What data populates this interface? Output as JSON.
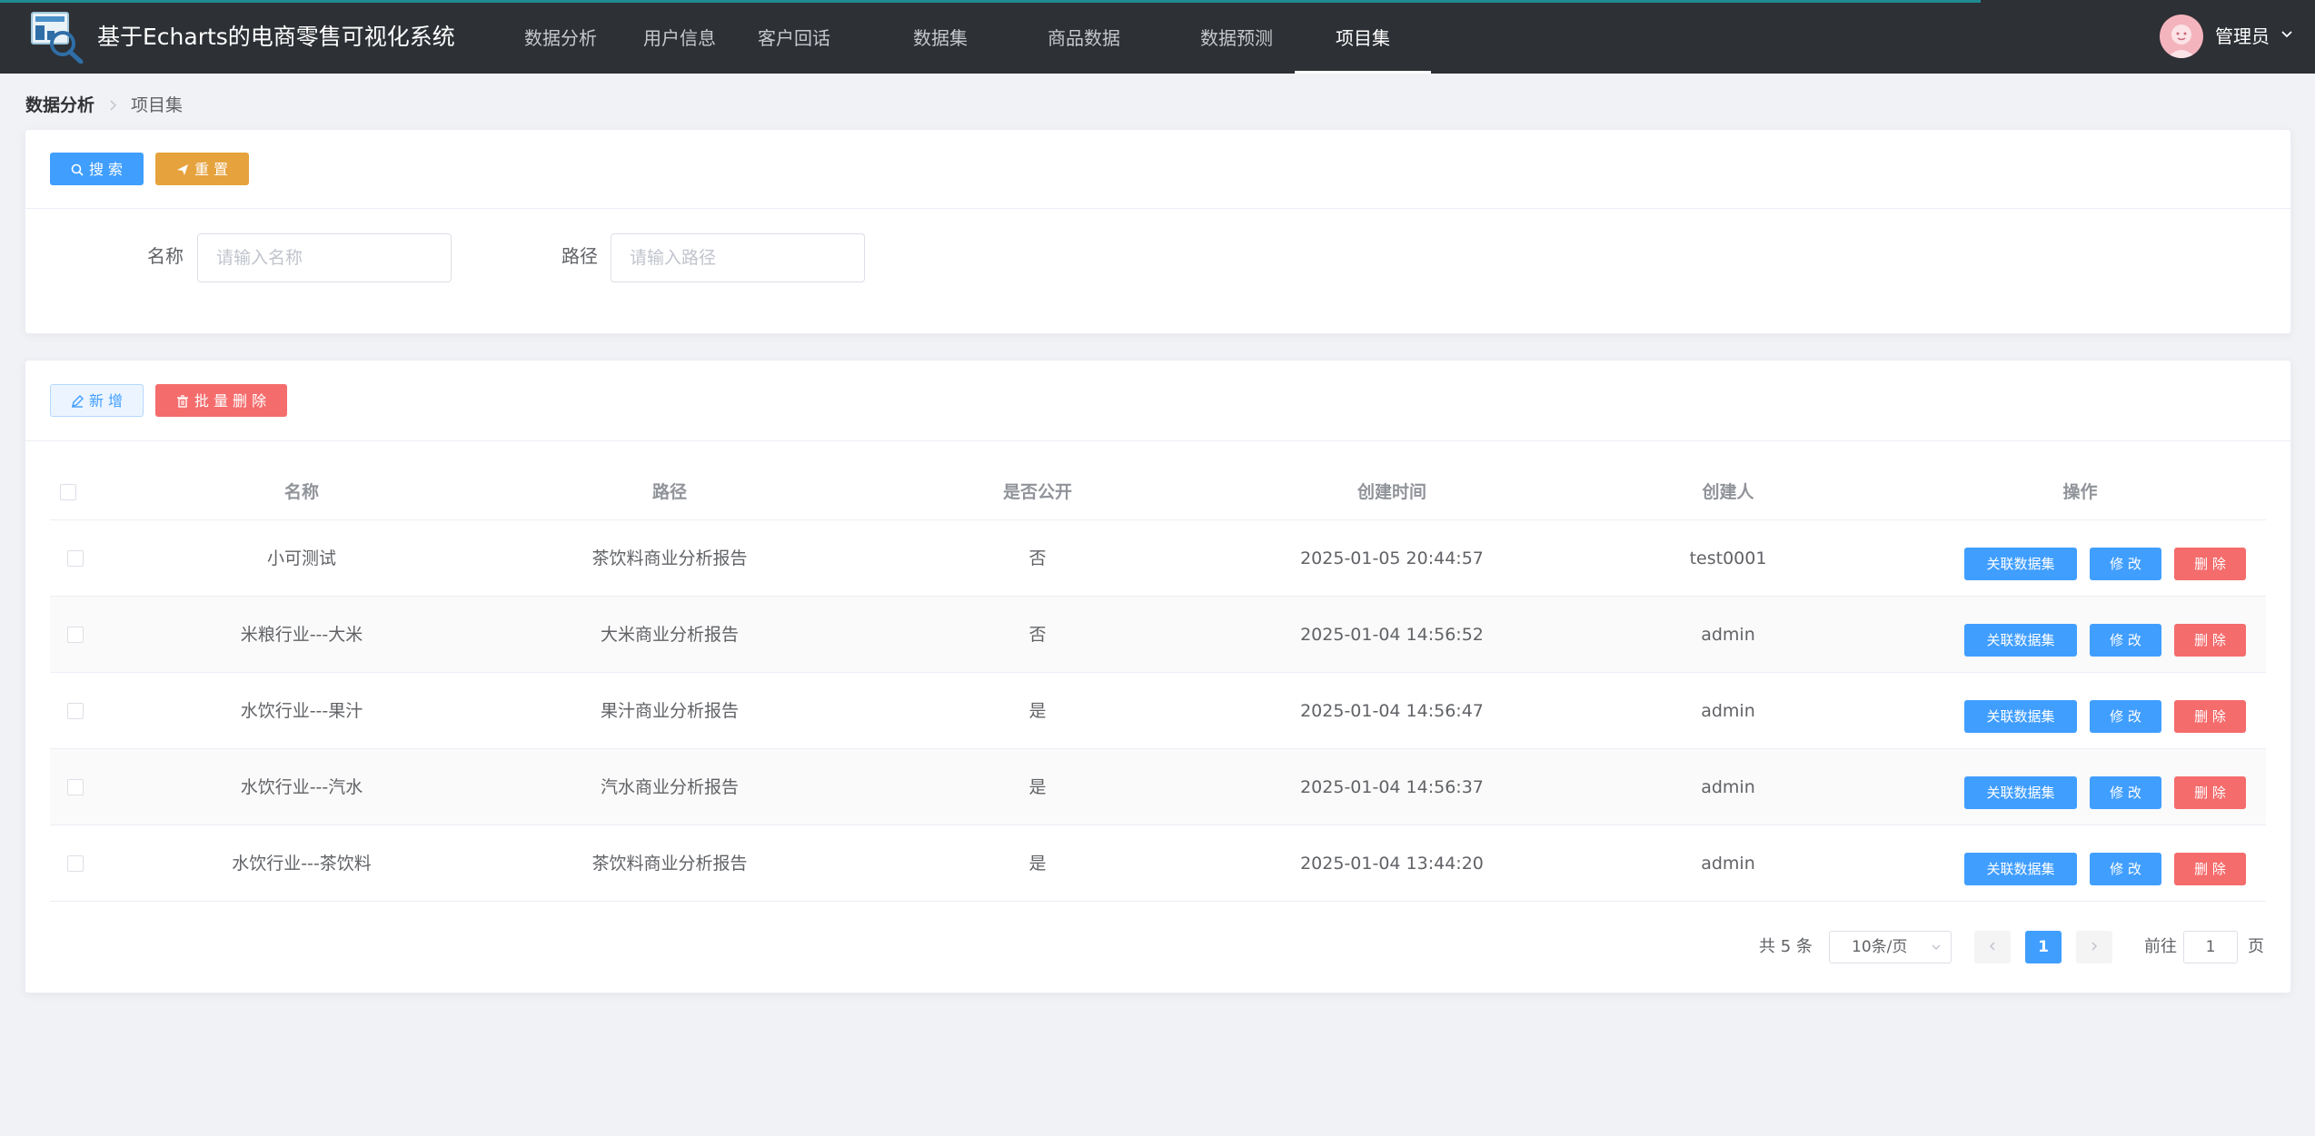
{
  "app": {
    "title": "基于Echarts的电商零售可视化系统"
  },
  "nav": {
    "items": [
      {
        "label": "数据分析"
      },
      {
        "label": "用户信息"
      },
      {
        "label": "客户回话"
      },
      {
        "label": "数据集"
      },
      {
        "label": "商品数据"
      },
      {
        "label": "数据预测"
      },
      {
        "label": "项目集"
      }
    ],
    "active": "项目集"
  },
  "user": {
    "name": "管理员"
  },
  "breadcrumb": {
    "root": "数据分析",
    "current": "项目集"
  },
  "search_panel": {
    "search_button": "搜 索",
    "reset_button": "重 置",
    "name_label": "名称",
    "name_placeholder": "请输入名称",
    "name_value": "",
    "path_label": "路径",
    "path_placeholder": "请输入路径",
    "path_value": ""
  },
  "toolbar": {
    "add_button": "新 增",
    "batch_delete_button": "批 量 删 除"
  },
  "table": {
    "columns": [
      "名称",
      "路径",
      "是否公开",
      "创建时间",
      "创建人",
      "操作"
    ],
    "action_labels": {
      "link": "关联数据集",
      "edit": "修 改",
      "delete": "删 除"
    },
    "rows": [
      {
        "name": "小可测试",
        "path": "茶饮料商业分析报告",
        "public": "否",
        "created_at": "2025-01-05 20:44:57",
        "creator": "test0001"
      },
      {
        "name": "米粮行业---大米",
        "path": "大米商业分析报告",
        "public": "否",
        "created_at": "2025-01-04 14:56:52",
        "creator": "admin"
      },
      {
        "name": "水饮行业---果汁",
        "path": "果汁商业分析报告",
        "public": "是",
        "created_at": "2025-01-04 14:56:47",
        "creator": "admin"
      },
      {
        "name": "水饮行业---汽水",
        "path": "汽水商业分析报告",
        "public": "是",
        "created_at": "2025-01-04 14:56:37",
        "creator": "admin"
      },
      {
        "name": "水饮行业---茶饮料",
        "path": "茶饮料商业分析报告",
        "public": "是",
        "created_at": "2025-01-04 13:44:20",
        "creator": "admin"
      }
    ]
  },
  "pagination": {
    "total_text": "共 5 条",
    "page_size": "10条/页",
    "current_page": "1",
    "goto_label": "前往",
    "goto_value": "1",
    "page_unit": "页"
  },
  "colors": {
    "navbar_bg": "#2d3035",
    "primary": "#409eff",
    "warning": "#e6a23c",
    "danger": "#f56c6c"
  }
}
